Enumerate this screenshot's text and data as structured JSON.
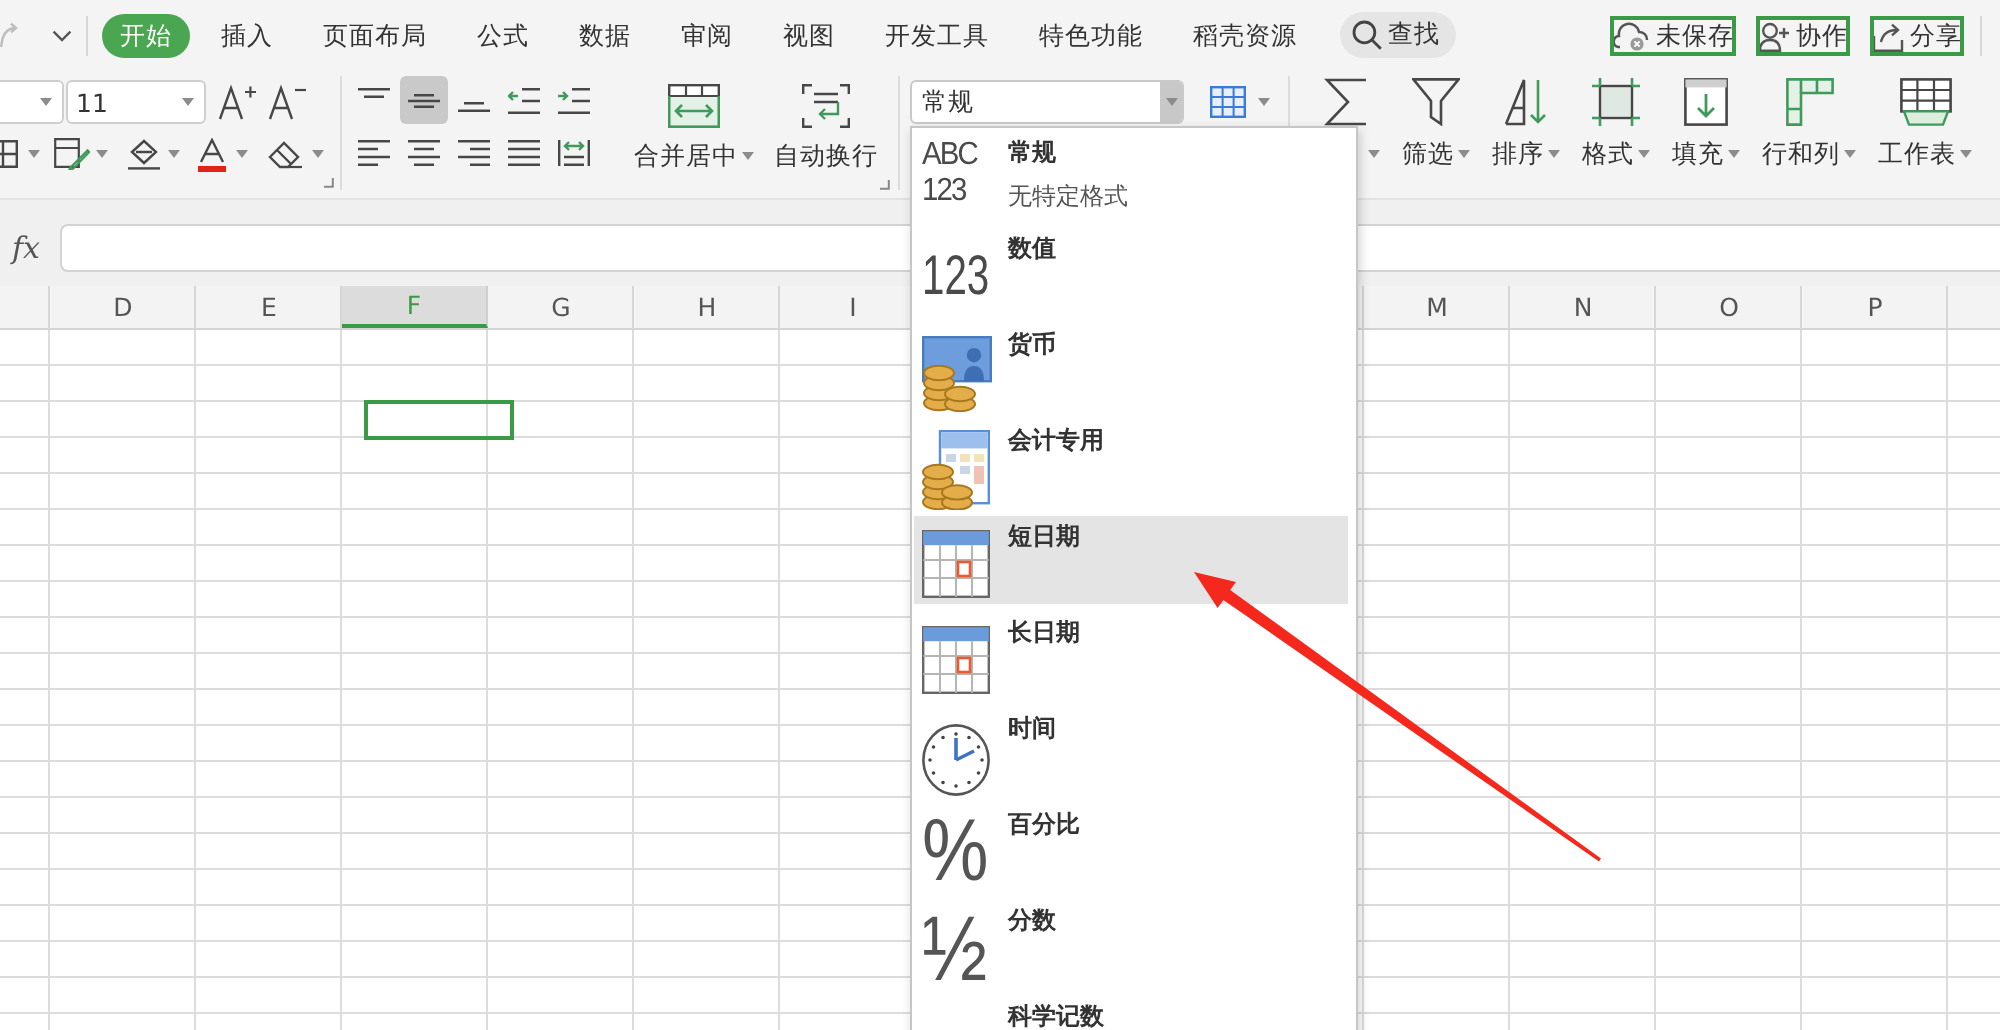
{
  "tabs": [
    {
      "label": "开始",
      "selected": true
    },
    {
      "label": "插入",
      "selected": false
    },
    {
      "label": "页面布局",
      "selected": false
    },
    {
      "label": "公式",
      "selected": false
    },
    {
      "label": "数据",
      "selected": false
    },
    {
      "label": "审阅",
      "selected": false
    },
    {
      "label": "视图",
      "selected": false
    },
    {
      "label": "开发工具",
      "selected": false
    },
    {
      "label": "特色功能",
      "selected": false
    },
    {
      "label": "稻壳资源",
      "selected": false
    }
  ],
  "search": {
    "label": "查找"
  },
  "actions": [
    {
      "kind": "unsaved",
      "label": "未保存"
    },
    {
      "kind": "collaborate",
      "label": "协作"
    },
    {
      "kind": "share",
      "label": "分享"
    }
  ],
  "ribbon": {
    "font_size": {
      "value": "11"
    },
    "alignment": {
      "top_row": [
        {
          "kind": "align-top",
          "selected": false
        },
        {
          "kind": "align-middle",
          "selected": true
        },
        {
          "kind": "align-bottom",
          "selected": false
        },
        {
          "kind": "decrease-indent",
          "selected": false
        },
        {
          "kind": "increase-indent",
          "selected": false
        }
      ],
      "bottom_row": [
        {
          "kind": "align-left",
          "selected": false
        },
        {
          "kind": "align-center",
          "selected": false
        },
        {
          "kind": "align-right",
          "selected": false
        },
        {
          "kind": "justify",
          "selected": false
        },
        {
          "kind": "distribute",
          "selected": false
        }
      ]
    },
    "merge_button": {
      "label": "合并居中"
    },
    "wrap_button": {
      "label": "自动换行"
    },
    "number_format": {
      "value": "常规",
      "expanded": true
    },
    "tools": [
      {
        "kind": "sum"
      },
      {
        "kind": "filter",
        "label": "筛选"
      },
      {
        "kind": "sort",
        "label": "排序"
      },
      {
        "kind": "format",
        "label": "格式"
      },
      {
        "kind": "fill",
        "label": "填充"
      },
      {
        "kind": "rows-columns",
        "label": "行和列"
      },
      {
        "kind": "worksheet",
        "label": "工作表"
      }
    ]
  },
  "formula_bar": {
    "label": "fx"
  },
  "sheet": {
    "columns_left": [
      {
        "label": "D",
        "selected": false
      },
      {
        "label": "E",
        "selected": false
      },
      {
        "label": "F",
        "selected": true
      },
      {
        "label": "G",
        "selected": false
      },
      {
        "label": "H",
        "selected": false
      },
      {
        "label": "I",
        "selected": false
      }
    ],
    "columns_right": [
      {
        "label": "M",
        "selected": false
      },
      {
        "label": "N",
        "selected": false
      },
      {
        "label": "O",
        "selected": false
      },
      {
        "label": "P",
        "selected": false
      }
    ],
    "rows": [
      {
        "selected": false
      },
      {
        "selected": false
      },
      {
        "selected": true
      },
      {
        "selected": false
      },
      {
        "selected": false
      },
      {
        "selected": false
      },
      {
        "selected": false
      },
      {
        "selected": false
      },
      {
        "selected": false
      },
      {
        "selected": false
      },
      {
        "selected": false
      },
      {
        "selected": false
      },
      {
        "selected": false
      },
      {
        "selected": false
      },
      {
        "selected": false
      },
      {
        "selected": false
      },
      {
        "selected": false
      },
      {
        "selected": false
      },
      {
        "selected": false
      }
    ]
  },
  "format_menu": {
    "items": [
      {
        "kind": "general",
        "icon_text": [
          "ABC",
          "123"
        ],
        "label": "常规",
        "description": "无特定格式",
        "selected": false
      },
      {
        "kind": "number",
        "icon_text": [
          "123"
        ],
        "label": "数值",
        "selected": false
      },
      {
        "kind": "currency",
        "label": "货币",
        "selected": false
      },
      {
        "kind": "accounting",
        "label": "会计专用",
        "selected": false
      },
      {
        "kind": "short-date",
        "label": "短日期",
        "selected": true
      },
      {
        "kind": "long-date",
        "label": "长日期",
        "selected": false
      },
      {
        "kind": "time",
        "label": "时间",
        "selected": false
      },
      {
        "kind": "percent",
        "icon_text": [
          "%"
        ],
        "label": "百分比",
        "selected": false
      },
      {
        "kind": "fraction",
        "icon_text": [
          "½"
        ],
        "label": "分数",
        "selected": false
      },
      {
        "kind": "scientific",
        "label": "科学记数",
        "selected": false
      }
    ]
  }
}
